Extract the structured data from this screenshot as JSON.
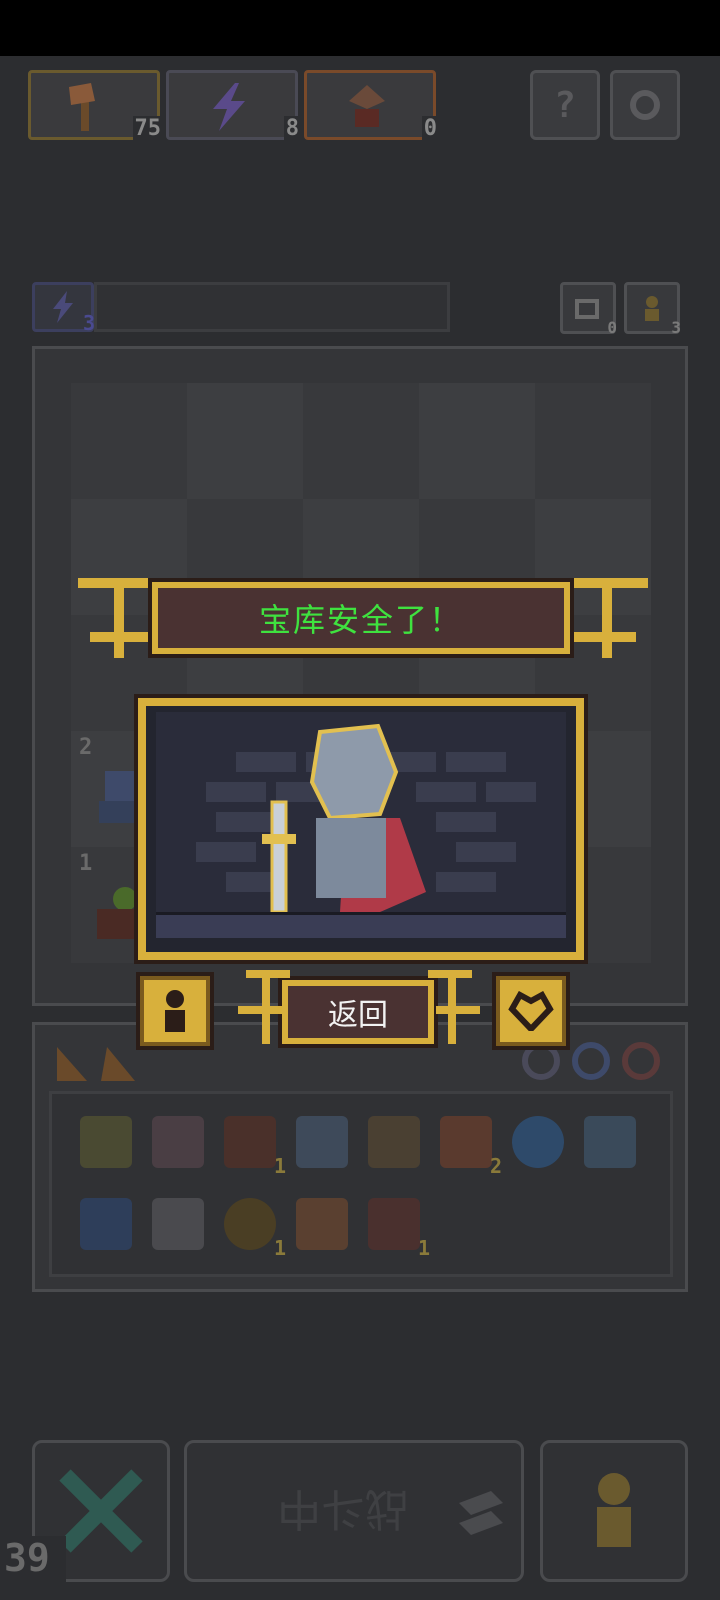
{
  "resources": [
    {
      "icon": "axe-icon",
      "count": "75"
    },
    {
      "icon": "lightning-icon",
      "count": "8"
    },
    {
      "icon": "altar-icon",
      "count": "0"
    }
  ],
  "top_buttons": {
    "help": "?",
    "settings_icon": "gear-icon"
  },
  "energy": {
    "count": "3"
  },
  "side_counts": {
    "undo": "0",
    "units": "3"
  },
  "board_units": [
    {
      "level": "2",
      "icon": "demon-unit-icon"
    },
    {
      "level": "1",
      "icon": "plant-unit-icon"
    }
  ],
  "modal": {
    "title": "宝库安全了！",
    "return_label": "返回",
    "left_icon": "pawn-icon",
    "right_icon": "heart-icon"
  },
  "inventory": {
    "row1": [
      {
        "icon": "dice-icon",
        "count": ""
      },
      {
        "icon": "flower-icon",
        "count": ""
      },
      {
        "icon": "scroll-icon",
        "count": "1"
      },
      {
        "icon": "mask-icon",
        "count": ""
      },
      {
        "icon": "claw-icon",
        "count": ""
      },
      {
        "icon": "axe-icon",
        "count": "2"
      },
      {
        "icon": "orb-icon",
        "count": ""
      },
      {
        "icon": "blade-icon",
        "count": ""
      }
    ],
    "row2": [
      {
        "icon": "wind-icon",
        "count": ""
      },
      {
        "icon": "mirror-icon",
        "count": ""
      },
      {
        "icon": "coin-icon",
        "count": "1"
      },
      {
        "icon": "shell-icon",
        "count": ""
      },
      {
        "icon": "altar-icon",
        "count": "1"
      }
    ]
  },
  "bottom": {
    "fight_label": "战斗中",
    "turn": "39"
  }
}
